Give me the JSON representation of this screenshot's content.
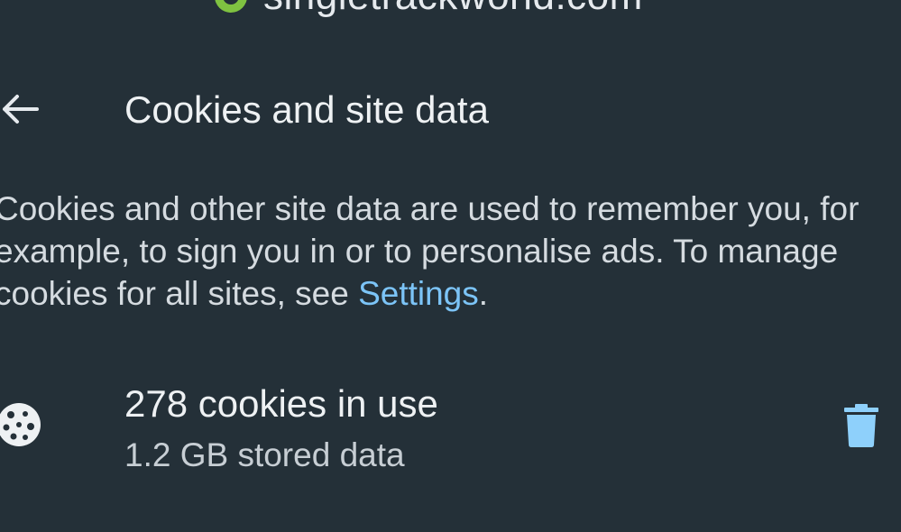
{
  "site": {
    "domain": "singletrackworld.com",
    "favicon_icon": "site-favicon"
  },
  "header": {
    "title": "Cookies and site data",
    "back_icon": "arrow-left-icon"
  },
  "description": {
    "text_before_link": "Cookies and other site data are used to remember you, for example, to sign you in or to personalise ads. To manage cookies for all sites, see ",
    "link_label": "Settings",
    "text_after_link": "."
  },
  "usage": {
    "title": "278 cookies in use",
    "subtitle": "1.2 GB stored data",
    "icon": "cookie-icon",
    "delete_icon": "trash-icon"
  },
  "colors": {
    "background": "#243038",
    "text_primary": "#eef1f3",
    "text_secondary": "#c7ced4",
    "link": "#7cc4f7",
    "delete_icon": "#8ed0fb",
    "favicon": "#7fc241"
  }
}
